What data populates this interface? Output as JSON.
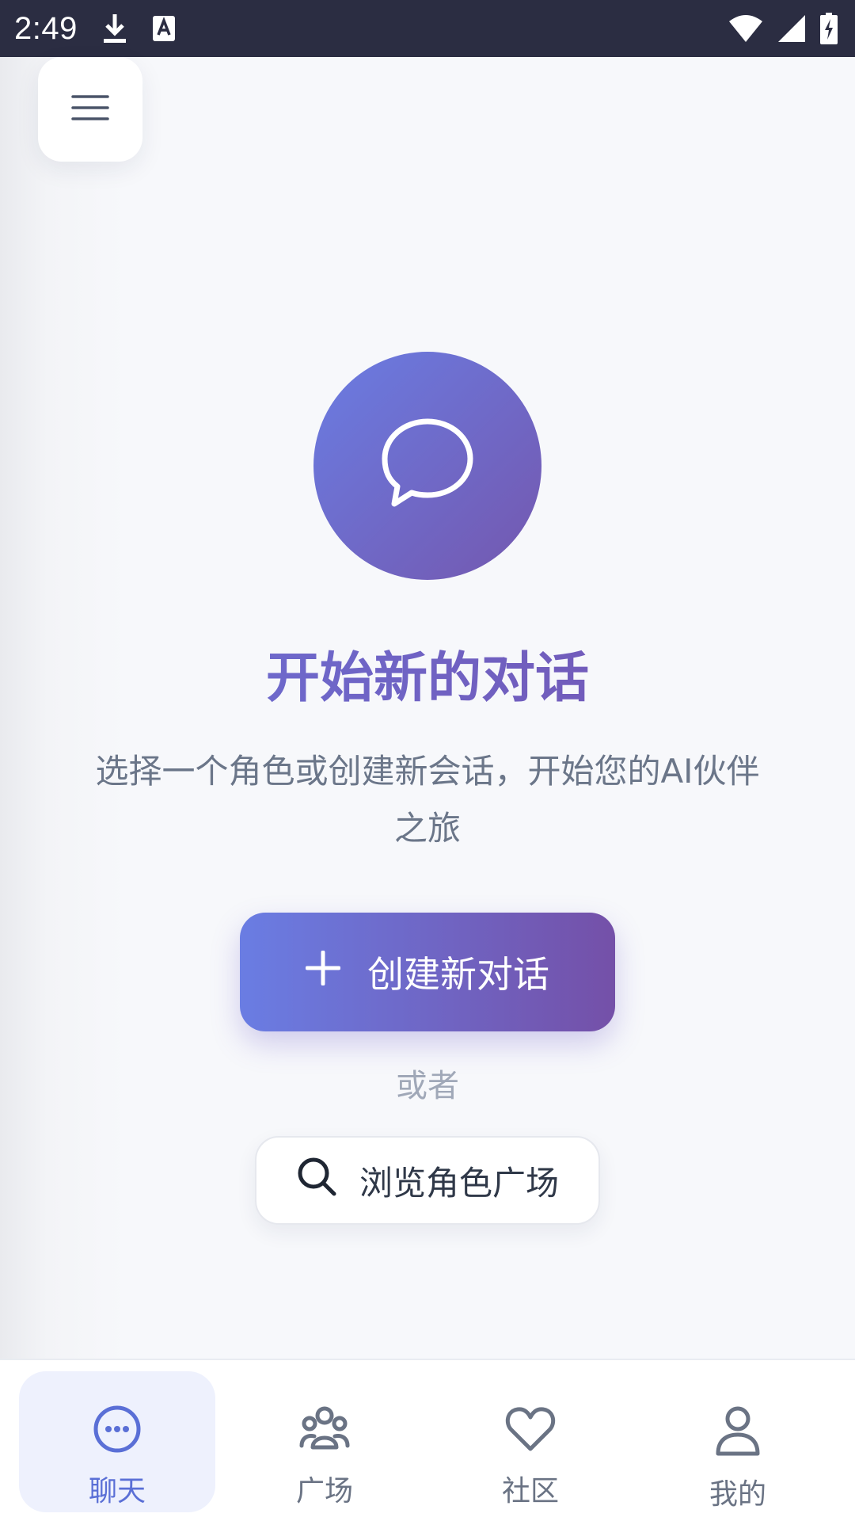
{
  "status_bar": {
    "time": "2:49",
    "icons": [
      "download-icon",
      "text-a-icon",
      "wifi-icon",
      "signal-icon",
      "battery-charging-icon"
    ]
  },
  "menu": {
    "icon": "hamburger-menu-icon"
  },
  "hero": {
    "icon": "chat-bubble-icon",
    "title": "开始新的对话",
    "subtitle": "选择一个角色或创建新会话，开始您的AI伙伴之旅"
  },
  "actions": {
    "create_label": "创建新对话",
    "or_label": "或者",
    "browse_label": "浏览角色广场"
  },
  "bottom_nav": {
    "items": [
      {
        "label": "聊天",
        "icon": "chat-dots-icon",
        "active": true
      },
      {
        "label": "广场",
        "icon": "group-icon",
        "active": false
      },
      {
        "label": "社区",
        "icon": "heart-icon",
        "active": false
      },
      {
        "label": "我的",
        "icon": "person-icon",
        "active": false
      }
    ]
  },
  "colors": {
    "accent_start": "#6a7de3",
    "accent_end": "#7450a8",
    "status_bar": "#2b2d42",
    "nav_active": "#5a6fd6",
    "nav_inactive": "#6a7384"
  }
}
